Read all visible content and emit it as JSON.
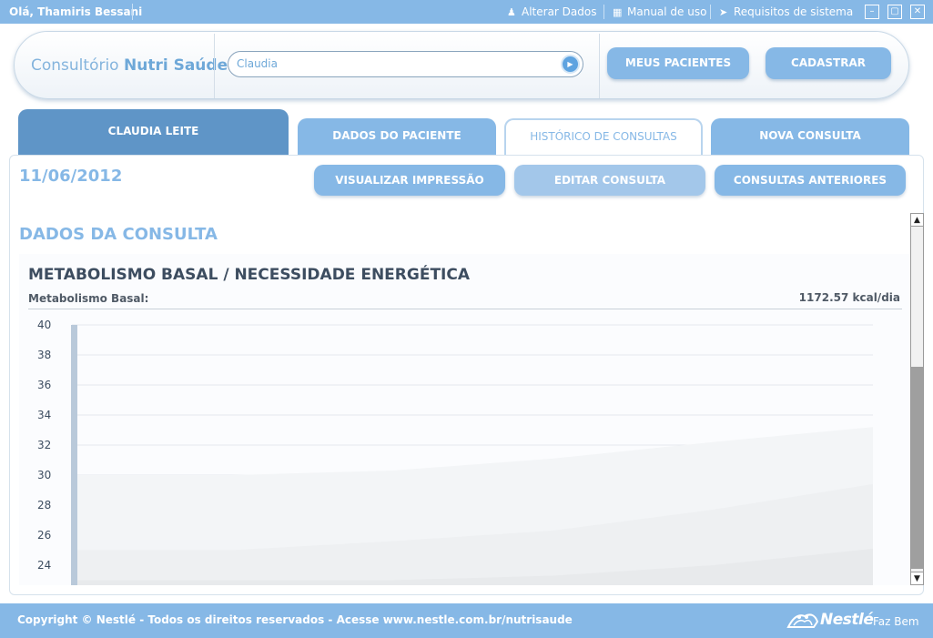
{
  "topbar": {
    "greeting": "Olá, Thamiris Bessani",
    "links": [
      {
        "label": "Alterar Dados",
        "icon": "people-icon"
      },
      {
        "label": "Manual de uso",
        "icon": "book-icon"
      },
      {
        "label": "Requisitos de sistema",
        "icon": "tag-icon"
      }
    ],
    "window_buttons": [
      "minimize",
      "maximize",
      "close"
    ]
  },
  "header": {
    "brand_prefix": "Consultório",
    "brand_name": "Nutri Saúde",
    "search_value": "Claudia",
    "buttons": {
      "patients": "MEUS PACIENTES",
      "register": "CADASTRAR"
    }
  },
  "tabs": {
    "patient": "CLAUDIA LEITE",
    "items": [
      "DADOS DO PACIENTE",
      "HISTÓRICO DE CONSULTAS",
      "NOVA CONSULTA"
    ],
    "active": "HISTÓRICO DE CONSULTAS"
  },
  "consult": {
    "date": "11/06/2012",
    "actions": [
      "VISUALIZAR IMPRESSÃO",
      "EDITAR CONSULTA",
      "CONSULTAS ANTERIORES"
    ],
    "section_title": "DADOS DA CONSULTA",
    "card_title": "METABOLISMO BASAL / NECESSIDADE ENERGÉTICA",
    "mb_label": "Metabolismo Basal:",
    "mb_value": "1172.57 kcal/dia"
  },
  "chart_data": {
    "type": "area",
    "title": "",
    "xlabel": "",
    "ylabel": "",
    "ylim": [
      23,
      40
    ],
    "yticks": [
      40,
      38,
      36,
      34,
      32,
      30,
      28,
      26,
      24
    ],
    "grid": true,
    "bar_value": 40,
    "x": [
      0,
      0.2,
      0.4,
      0.6,
      0.8,
      1.0
    ],
    "series": [
      {
        "values": [
          30,
          30,
          30.3,
          31.1,
          32.2,
          33.2
        ]
      },
      {
        "values": [
          25,
          25,
          25.6,
          26.3,
          27.7,
          29.4
        ]
      },
      {
        "values": [
          23,
          23,
          23,
          23.3,
          24,
          25.1
        ]
      }
    ]
  },
  "colors": {
    "accent": "#86b8e6",
    "accent_dark": "#5f95c7",
    "title_dark": "#3d4d60"
  },
  "footer": {
    "copyright": "Copyright © Nestlé - Todos os direitos reservados - Acesse www.nestle.com.br/nutrisaude",
    "brand": "Nestlé",
    "slogan": "Faz Bem"
  }
}
